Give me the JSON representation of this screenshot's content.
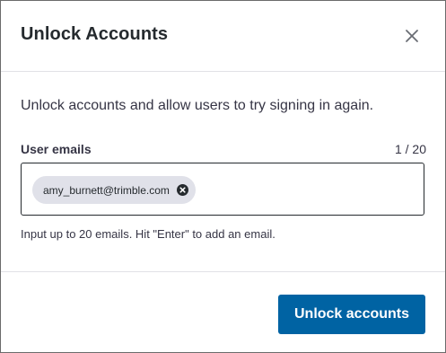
{
  "dialog": {
    "title": "Unlock Accounts",
    "close_icon": "close-icon"
  },
  "body": {
    "description": "Unlock accounts and allow users to try signing in again.",
    "field_label": "User emails",
    "counter": "1 / 20",
    "emails": [
      "amy_burnett@trimble.com"
    ],
    "chip_remove_icon": "x-circle-icon",
    "helper_text": "Input up to 20 emails. Hit \"Enter\" to add an email."
  },
  "footer": {
    "primary_button_label": "Unlock accounts"
  },
  "colors": {
    "primary": "#0063a3",
    "chip_background": "#e0e1e9",
    "text": "#363545",
    "title_text": "#252a2e",
    "divider": "#e1e1e6"
  }
}
